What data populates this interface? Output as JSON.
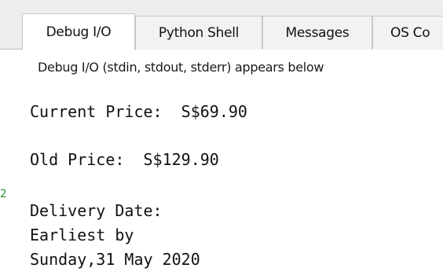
{
  "tabs": [
    {
      "label": "Debug I/O",
      "active": true
    },
    {
      "label": "Python Shell",
      "active": false
    },
    {
      "label": "Messages",
      "active": false
    },
    {
      "label": "OS Co",
      "active": false
    }
  ],
  "debug_io": {
    "caption": "Debug I/O (stdin, stdout, stderr) appears below",
    "output_lines": [
      "Current Price:  S$69.90",
      "Old Price:  S$129.90",
      "Delivery Date:",
      "Earliest by",
      "Sunday,31 May 2020"
    ]
  },
  "gutter_mark": "2",
  "colors": {
    "tab_bar_bg": "#eeeeee",
    "active_tab_bg": "#ffffff",
    "gutter_mark": "#2e8b2e"
  }
}
